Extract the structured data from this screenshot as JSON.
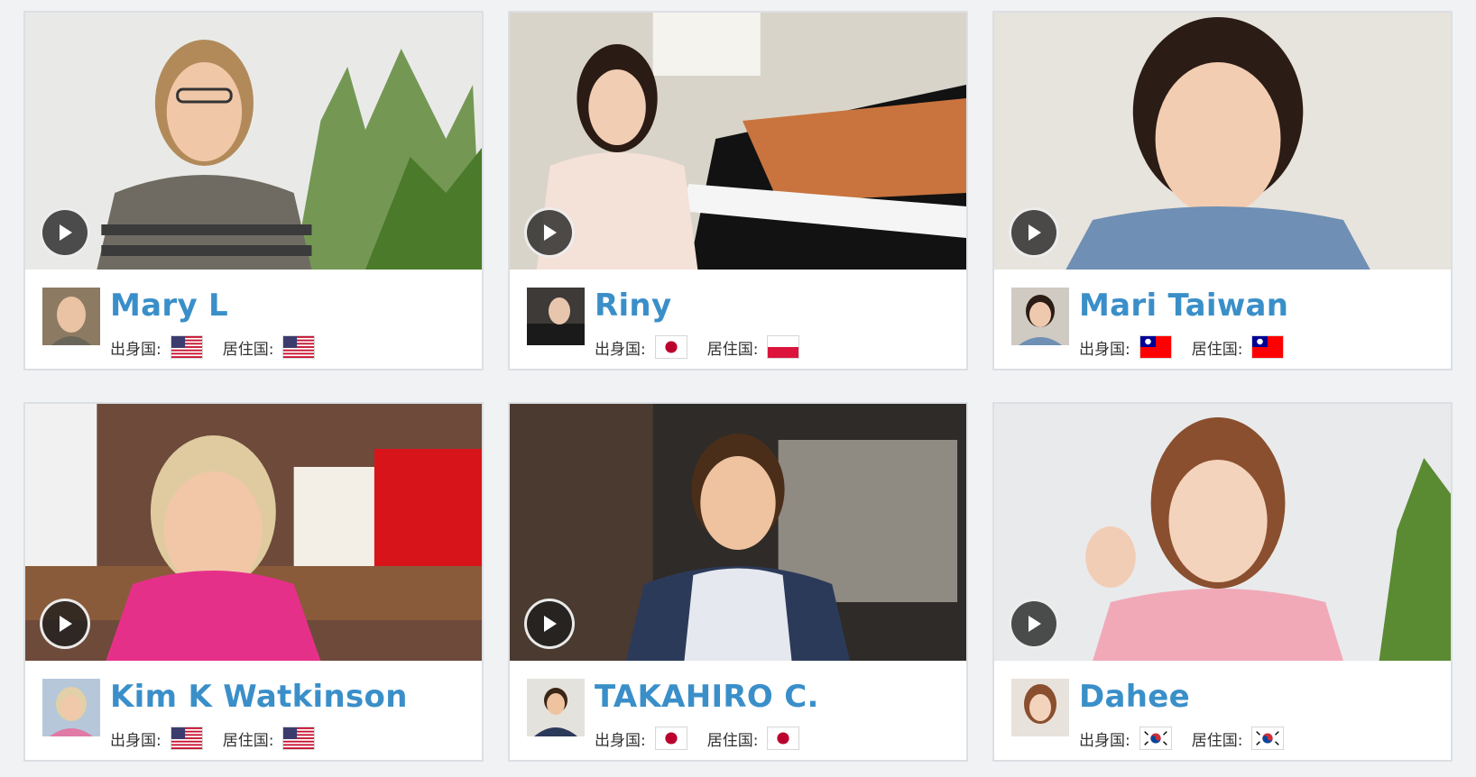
{
  "labels": {
    "origin": "出身国:",
    "residence": "居住国:"
  },
  "teachers": [
    {
      "name": "Mary L",
      "origin_flag": "flag-us-icon",
      "residence_flag": "flag-us-icon"
    },
    {
      "name": "Riny",
      "origin_flag": "flag-jp-icon",
      "residence_flag": "flag-pl-icon"
    },
    {
      "name": "Mari Taiwan",
      "origin_flag": "flag-tw-icon",
      "residence_flag": "flag-tw-icon"
    },
    {
      "name": "Kim K Watkinson",
      "origin_flag": "flag-us-icon",
      "residence_flag": "flag-us-icon"
    },
    {
      "name": "TAKAHIRO C.",
      "origin_flag": "flag-jp-icon",
      "residence_flag": "flag-jp-icon"
    },
    {
      "name": "Dahee",
      "origin_flag": "flag-kr-icon",
      "residence_flag": "flag-kr-icon"
    }
  ]
}
